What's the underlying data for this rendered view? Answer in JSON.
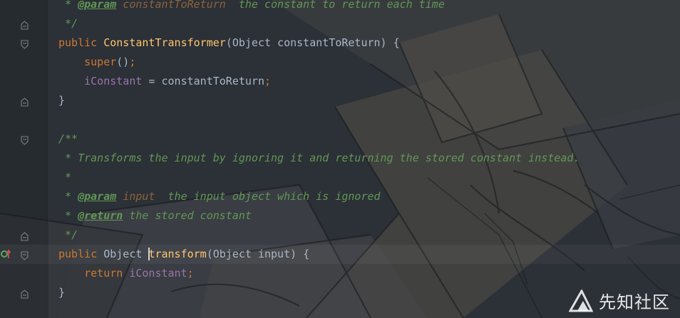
{
  "editor": {
    "language": "Java",
    "lines": [
      [
        {
          "t": "cm",
          "v": " * "
        },
        {
          "t": "tag",
          "v": "@param"
        },
        {
          "t": "cm",
          "v": " "
        },
        {
          "t": "pn",
          "v": "constantToReturn"
        },
        {
          "t": "cm",
          "v": "  the constant to return each time"
        }
      ],
      [
        {
          "t": "cm",
          "v": " */"
        }
      ],
      [
        {
          "t": "kw",
          "v": "public "
        },
        {
          "t": "fn",
          "v": "ConstantTransformer"
        },
        {
          "t": "pl",
          "v": "(Object constantToReturn) {"
        }
      ],
      [
        {
          "t": "pl",
          "v": "    "
        },
        {
          "t": "kw",
          "v": "super"
        },
        {
          "t": "pl",
          "v": "()"
        },
        {
          "t": "kw",
          "v": ";"
        }
      ],
      [
        {
          "t": "pl",
          "v": "    "
        },
        {
          "t": "fld",
          "v": "iConstant"
        },
        {
          "t": "pl",
          "v": " = constantToReturn"
        },
        {
          "t": "kw",
          "v": ";"
        }
      ],
      [
        {
          "t": "pl",
          "v": "}"
        }
      ],
      [],
      [
        {
          "t": "cm",
          "v": "/**"
        }
      ],
      [
        {
          "t": "cm",
          "v": " * Transforms the input by ignoring it and returning the stored constant instead."
        }
      ],
      [
        {
          "t": "cm",
          "v": " *"
        }
      ],
      [
        {
          "t": "cm",
          "v": " * "
        },
        {
          "t": "tag",
          "v": "@param"
        },
        {
          "t": "cm",
          "v": " "
        },
        {
          "t": "pn",
          "v": "input"
        },
        {
          "t": "cm",
          "v": "  the input object which is ignored"
        }
      ],
      [
        {
          "t": "cm",
          "v": " * "
        },
        {
          "t": "tag",
          "v": "@return"
        },
        {
          "t": "cm",
          "v": " the stored constant"
        }
      ],
      [
        {
          "t": "cm",
          "v": " */"
        }
      ],
      [
        {
          "t": "kw",
          "v": "public "
        },
        {
          "t": "pl",
          "v": "Object "
        },
        {
          "t": "caret",
          "v": ""
        },
        {
          "t": "fn",
          "v": "transform"
        },
        {
          "t": "pl",
          "v": "(Object input) {"
        }
      ],
      [
        {
          "t": "pl",
          "v": "    "
        },
        {
          "t": "kw",
          "v": "return "
        },
        {
          "t": "fld",
          "v": "iConstant"
        },
        {
          "t": "kw",
          "v": ";"
        }
      ],
      [
        {
          "t": "pl",
          "v": "}"
        }
      ]
    ],
    "current_line": 13,
    "fold_markers": [
      {
        "line": 1,
        "icon": "fold-end-icon"
      },
      {
        "line": 2,
        "icon": "fold-start-icon"
      },
      {
        "line": 5,
        "icon": "fold-end-icon"
      },
      {
        "line": 7,
        "icon": "fold-start-icon"
      },
      {
        "line": 12,
        "icon": "fold-end-icon"
      },
      {
        "line": 13,
        "icon": "fold-start-icon"
      },
      {
        "line": 15,
        "icon": "fold-end-icon"
      }
    ],
    "gutter_icons": [
      {
        "line": 13,
        "icon": "override-method-icon"
      }
    ]
  },
  "theme": {
    "keyword": "#cc7832",
    "function": "#ffc66d",
    "comment": "#629755",
    "doc_param": "#8a653b",
    "field": "#9876aa",
    "plain": "#a9b7c6"
  },
  "watermark": {
    "icon": "xianzhi-logo-icon",
    "text": "先知社区"
  }
}
